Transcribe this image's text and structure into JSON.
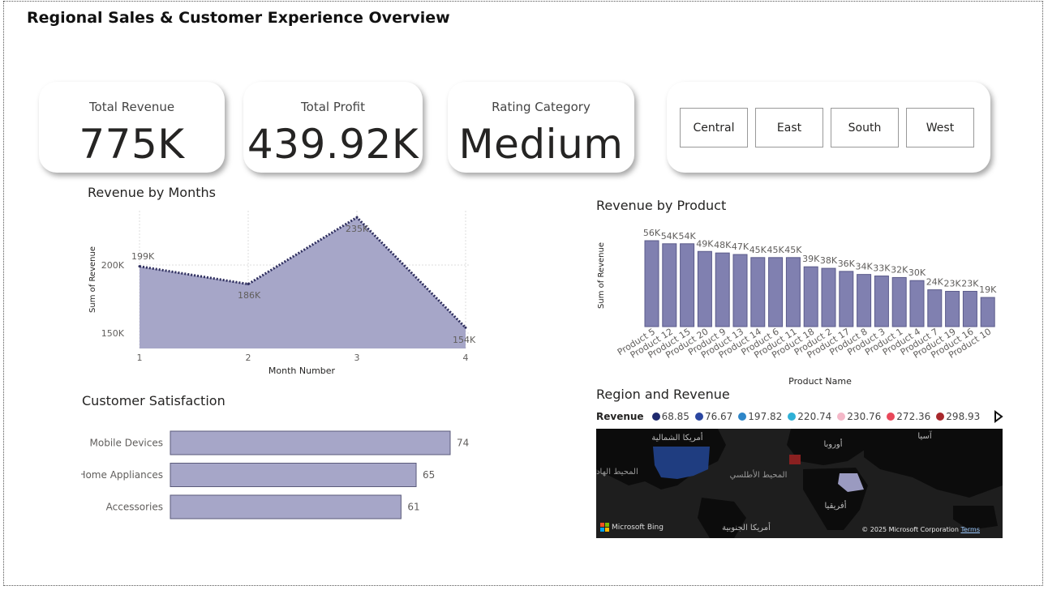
{
  "title": "Regional Sales & Customer Experience Overview",
  "cards": [
    {
      "label": "Total Revenue",
      "value": "775K"
    },
    {
      "label": "Total Profit",
      "value": "439.92K"
    },
    {
      "label": "Rating Category",
      "value": "Medium"
    }
  ],
  "regions": [
    "Central",
    "East",
    "South",
    "West"
  ],
  "area_chart": {
    "title": "Revenue by Months",
    "xlabel": "Month Number",
    "ylabel": "Sum of Revenue",
    "y_ticks": [
      "200K",
      "150K"
    ],
    "x_ticks": [
      "1",
      "2",
      "3",
      "4"
    ],
    "data_labels": [
      "199K",
      "186K",
      "235K",
      "154K"
    ]
  },
  "product_chart": {
    "title": "Revenue by Product",
    "xlabel": "Product Name",
    "ylabel": "Sum of Revenue",
    "data_labels": [
      "56K",
      "54K",
      "54K",
      "49K",
      "48K",
      "47K",
      "45K",
      "45K",
      "45K",
      "39K",
      "38K",
      "36K",
      "34K",
      "33K",
      "32K",
      "30K",
      "24K",
      "23K",
      "23K",
      "19K"
    ]
  },
  "satisfaction_chart": {
    "title": "Customer Satisfaction",
    "data_labels": [
      "74",
      "65",
      "61"
    ]
  },
  "map": {
    "title": "Region and Revenue",
    "legend_title": "Revenue",
    "legend": [
      {
        "label": "68.85",
        "color": "#1f2a6e"
      },
      {
        "label": "76.67",
        "color": "#2a46a0"
      },
      {
        "label": "197.82",
        "color": "#2e86c8"
      },
      {
        "label": "220.74",
        "color": "#2fb0d6"
      },
      {
        "label": "230.76",
        "color": "#f4b8c8"
      },
      {
        "label": "272.36",
        "color": "#e9485a"
      },
      {
        "label": "298.93",
        "color": "#a8282c"
      }
    ],
    "labels": {
      "north_america": "أمريكا الشمالية",
      "europe": "أوروبا",
      "asia": "آسيا",
      "pacific": "المحيط الهادي",
      "atlantic": "المحيط الأطلسي",
      "africa": "أفريقيا",
      "south_america": "أمريكا الجنوبية"
    },
    "logo": "Microsoft Bing",
    "copyright": "© 2025 Microsoft Corporation",
    "terms": "Terms"
  },
  "chart_data": [
    {
      "type": "area",
      "title": "Revenue by Months",
      "xlabel": "Month Number",
      "ylabel": "Sum of Revenue",
      "x": [
        1,
        2,
        3,
        4
      ],
      "values": [
        199000,
        186000,
        235000,
        154000
      ],
      "ylim": [
        140000,
        240000
      ],
      "grid": true,
      "color": "#a6a6c8"
    },
    {
      "type": "bar",
      "title": "Revenue by Product",
      "xlabel": "Product Name",
      "ylabel": "Sum of Revenue",
      "categories": [
        "Product 5",
        "Product 12",
        "Product 15",
        "Product 20",
        "Product 9",
        "Product 13",
        "Product 14",
        "Product 6",
        "Product 11",
        "Product 18",
        "Product 2",
        "Product 17",
        "Product 8",
        "Product 3",
        "Product 1",
        "Product 4",
        "Product 7",
        "Product 19",
        "Product 16",
        "Product 10"
      ],
      "values": [
        56000,
        54000,
        54000,
        49000,
        48000,
        47000,
        45000,
        45000,
        45000,
        39000,
        38000,
        36000,
        34000,
        33000,
        32000,
        30000,
        24000,
        23000,
        23000,
        19000
      ],
      "ylim": [
        0,
        56000
      ],
      "color": "#8080b0"
    },
    {
      "type": "bar",
      "orientation": "horizontal",
      "title": "Customer Satisfaction",
      "categories": [
        "Mobile Devices",
        "Home Appliances",
        "Accessories"
      ],
      "values": [
        74,
        65,
        61
      ],
      "color": "#a6a6c8"
    }
  ]
}
